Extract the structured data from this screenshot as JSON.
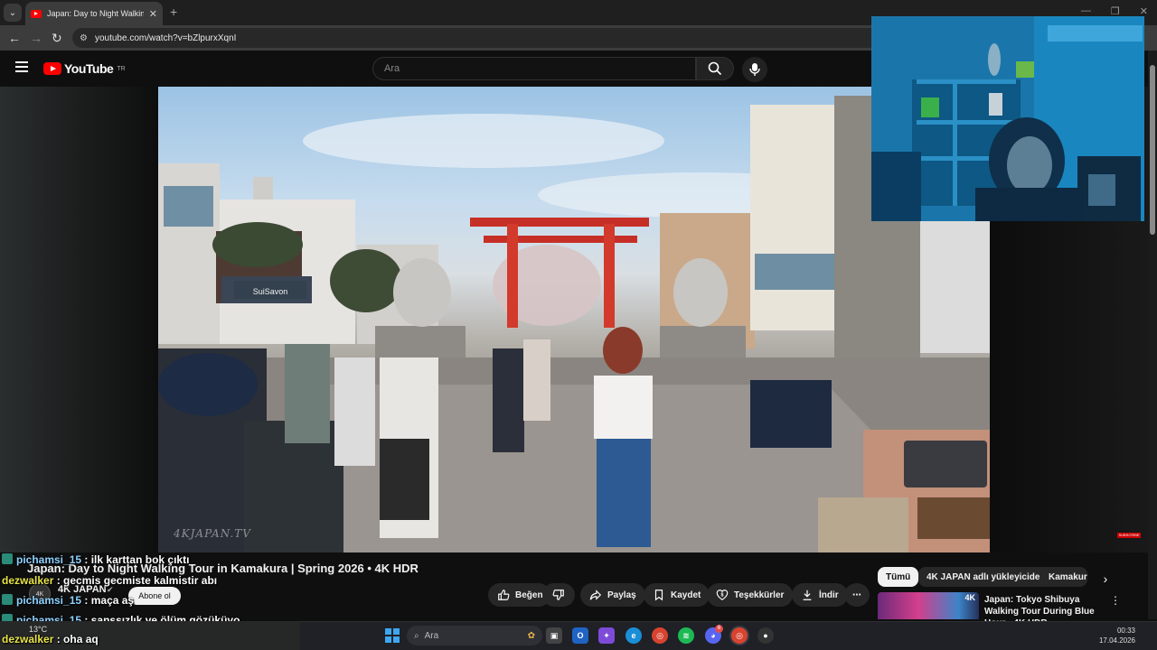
{
  "browser": {
    "tab_title": "Japan: Day to Night Walking Tour in Kamakura | Spring 2026 • 4K HDR",
    "url": "youtube.com/watch?v=bZlpurxXqnI"
  },
  "youtube": {
    "logo_text": "YouTube",
    "country_code": "TR",
    "search_placeholder": "Ara"
  },
  "video": {
    "watermark": "4KJAPAN.TV",
    "shop_sign": "SuiSavon",
    "subscribe_badge": "SUBSCRIBE",
    "title": "Japan: Day to Night Walking Tour in Kamakura | Spring 2026 • 4K HDR",
    "channel_name": "4K JAPAN",
    "subscribe_label": "Abone ol"
  },
  "actions": {
    "like": "Beğen",
    "share": "Paylaş",
    "save": "Kaydet",
    "thanks": "Teşekkürler",
    "download": "İndir"
  },
  "chat": [
    {
      "user": "pichamsi_15",
      "msg": "ilk karttan bok çıktı",
      "color": "#8fd1ff"
    },
    {
      "user": "dezwalker",
      "msg": "gecmis gecmiste kalmistir abı",
      "color": "#e7e44a"
    },
    {
      "user": "pichamsi_15",
      "msg": "maça aş",
      "color": "#8fd1ff"
    },
    {
      "user": "pichamsi_15",
      "msg": "şanssızlık ve ölüm gözüküyo",
      "color": "#8fd1ff"
    },
    {
      "user": "dezwalker",
      "msg": "oha aq",
      "color": "#e7e44a"
    }
  ],
  "sidebar": {
    "chips": [
      "Tümü",
      "4K JAPAN adlı yükleyiciden",
      "Kamakura"
    ],
    "recommendation": {
      "title": "Japan: Tokyo Shibuya Walking Tour During Blue Hour • 4K HDR",
      "badge": "4K"
    }
  },
  "taskbar": {
    "weather": "13°C",
    "search_placeholder": "Ara",
    "time": "00:33",
    "date": "17.04.2026",
    "discord_badge": "6"
  }
}
